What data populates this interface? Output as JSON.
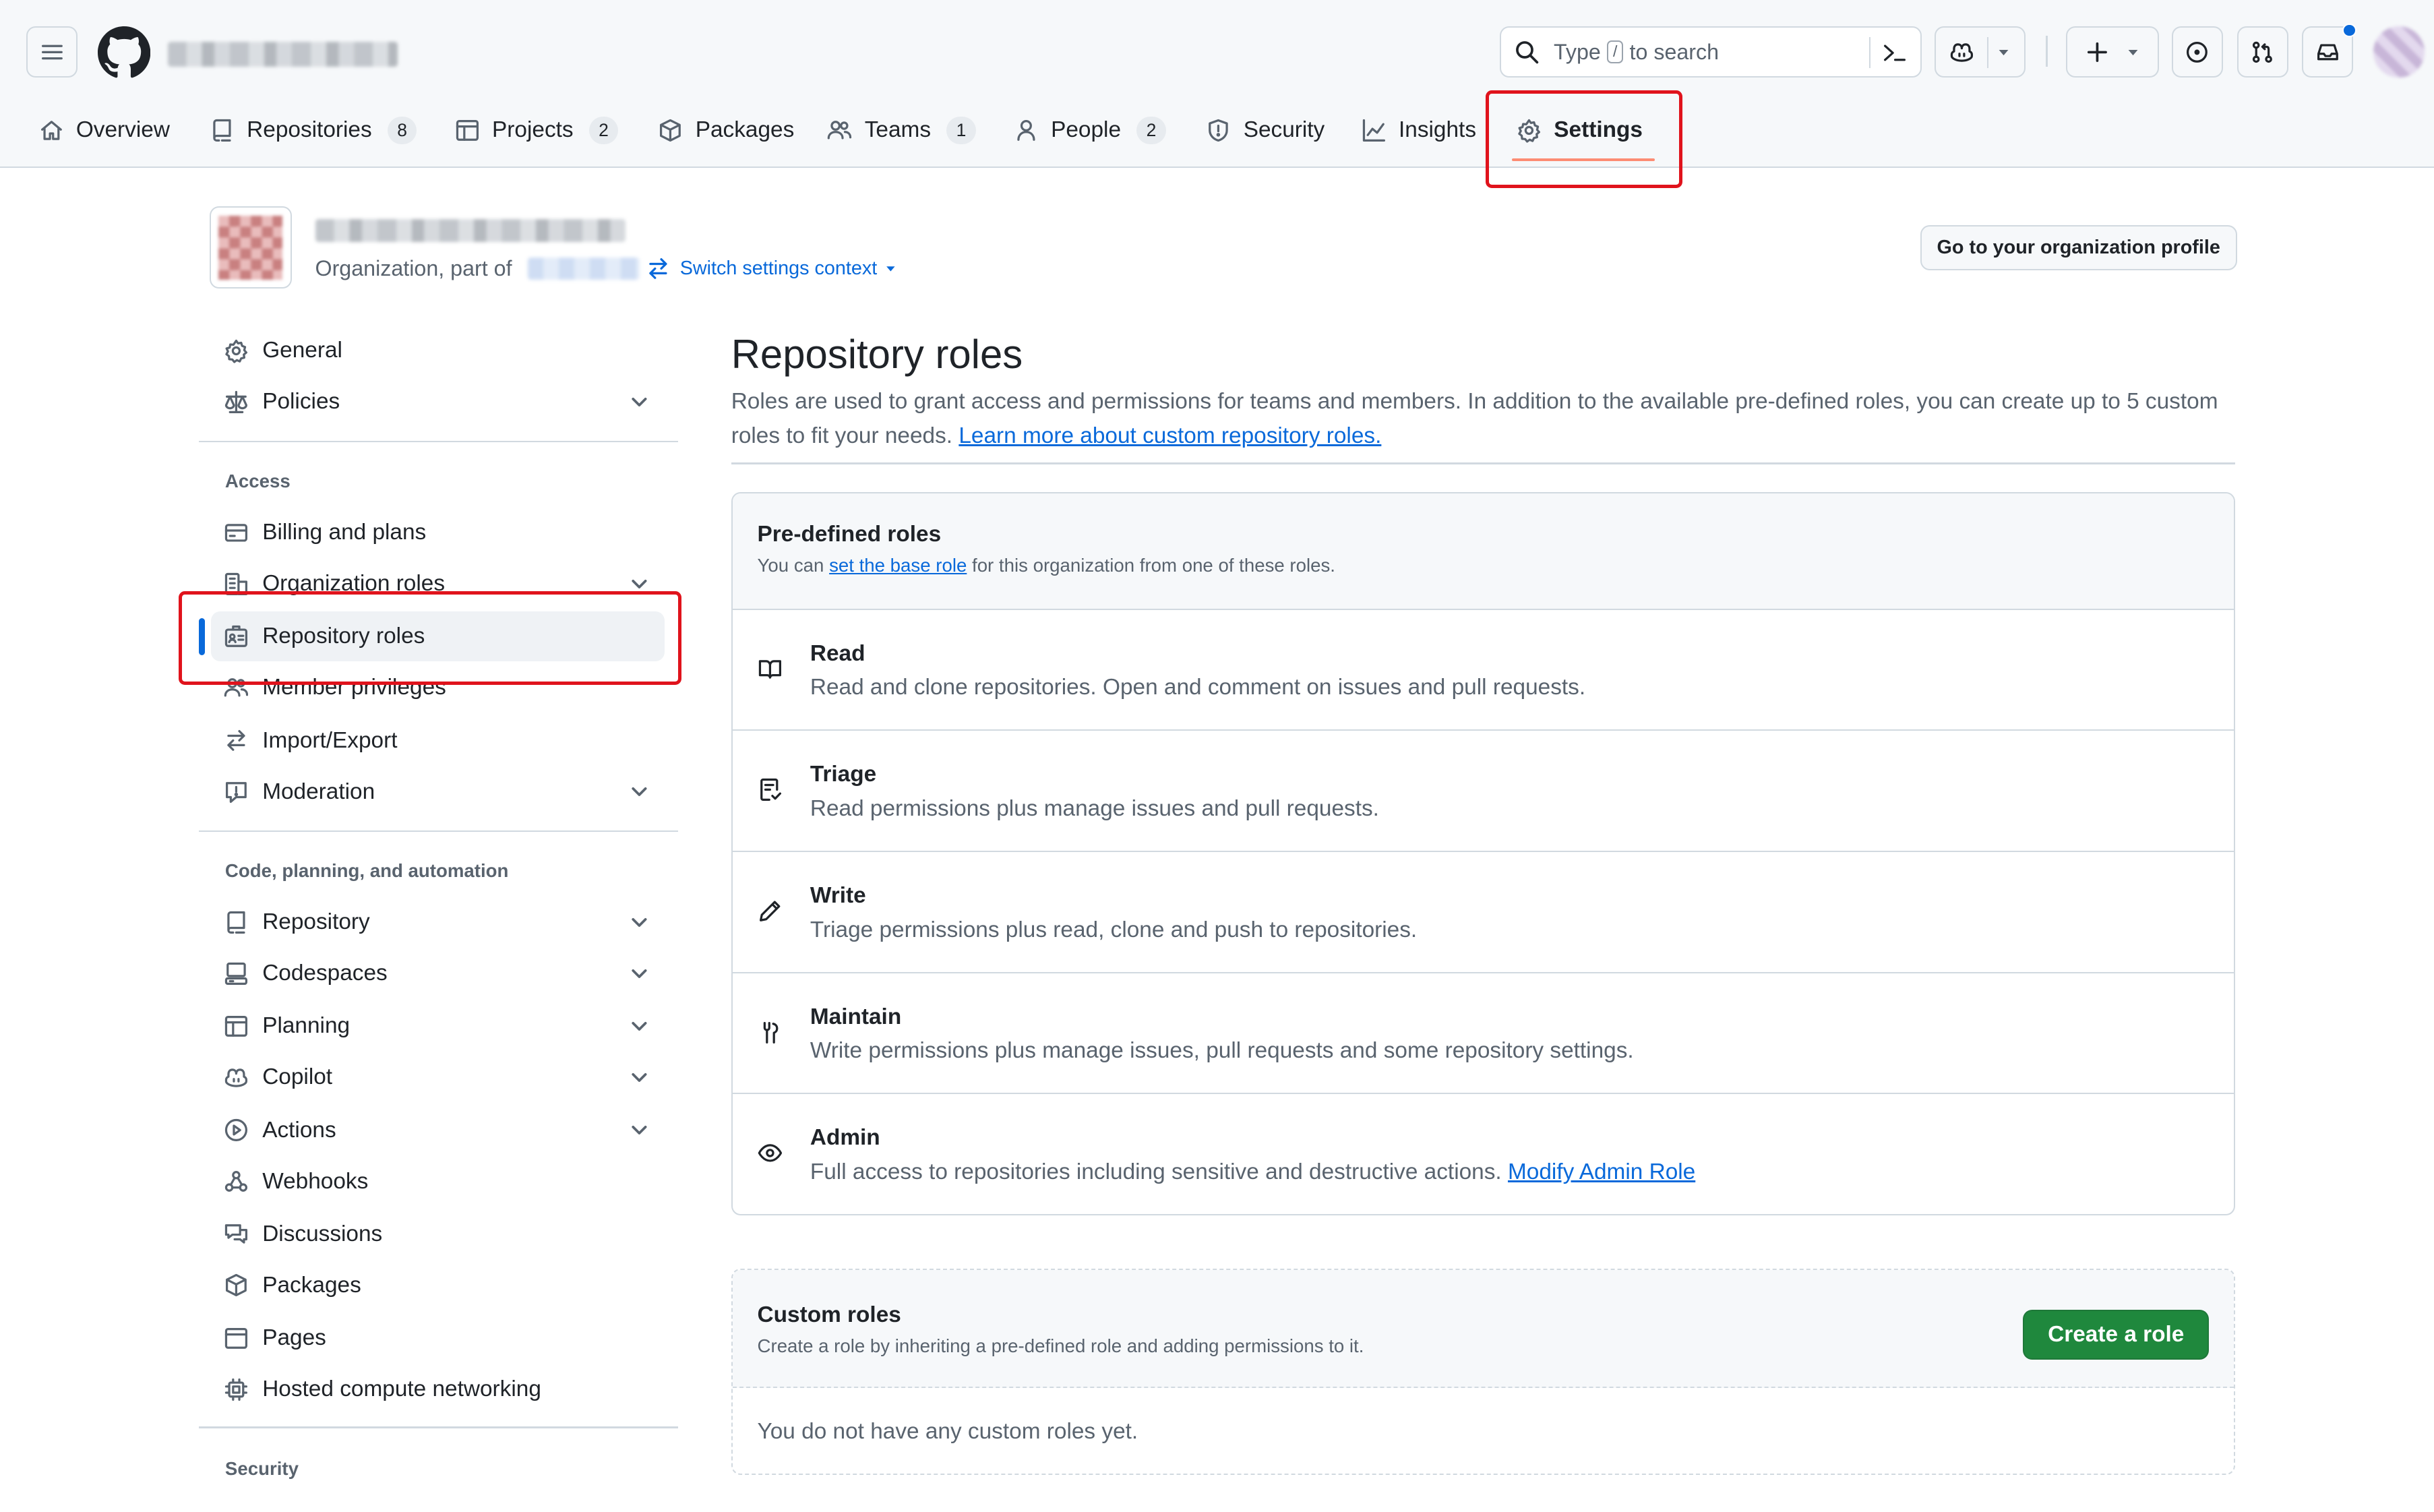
{
  "header": {
    "search_prefix": "Type",
    "search_key": "/",
    "search_suffix": "to search"
  },
  "tabs": [
    {
      "label": "Overview",
      "icon": "home-icon"
    },
    {
      "label": "Repositories",
      "count": "8",
      "icon": "repo-icon"
    },
    {
      "label": "Projects",
      "count": "2",
      "icon": "table-icon"
    },
    {
      "label": "Packages",
      "icon": "package-icon"
    },
    {
      "label": "Teams",
      "count": "1",
      "icon": "people-icon"
    },
    {
      "label": "People",
      "count": "2",
      "icon": "person-icon"
    },
    {
      "label": "Security",
      "icon": "shield-icon"
    },
    {
      "label": "Insights",
      "icon": "graph-icon"
    },
    {
      "label": "Settings",
      "icon": "gear-icon",
      "selected": true
    }
  ],
  "org": {
    "subtitle": "Organization, part of",
    "switch_label": "Switch settings context",
    "profile_button": "Go to your organization profile"
  },
  "sidebar": {
    "top": [
      {
        "label": "General",
        "icon": "gear-icon"
      },
      {
        "label": "Policies",
        "icon": "law-icon",
        "expandable": true
      }
    ],
    "access_heading": "Access",
    "access": [
      {
        "label": "Billing and plans",
        "icon": "credit-card-icon"
      },
      {
        "label": "Organization roles",
        "icon": "organization-icon",
        "expandable": true
      },
      {
        "label": "Repository roles",
        "icon": "id-badge-icon",
        "active": true
      },
      {
        "label": "Member privileges",
        "icon": "people-icon"
      },
      {
        "label": "Import/Export",
        "icon": "arrow-switch-icon"
      },
      {
        "label": "Moderation",
        "icon": "report-icon",
        "expandable": true
      }
    ],
    "code_heading": "Code, planning, and automation",
    "code": [
      {
        "label": "Repository",
        "icon": "repo-icon",
        "expandable": true
      },
      {
        "label": "Codespaces",
        "icon": "codespaces-icon",
        "expandable": true
      },
      {
        "label": "Planning",
        "icon": "table-icon",
        "expandable": true
      },
      {
        "label": "Copilot",
        "icon": "copilot-icon",
        "expandable": true
      },
      {
        "label": "Actions",
        "icon": "play-icon",
        "expandable": true
      },
      {
        "label": "Webhooks",
        "icon": "webhook-icon"
      },
      {
        "label": "Discussions",
        "icon": "comment-discussion-icon"
      },
      {
        "label": "Packages",
        "icon": "package-icon"
      },
      {
        "label": "Pages",
        "icon": "browser-icon"
      },
      {
        "label": "Hosted compute networking",
        "icon": "cpu-icon"
      }
    ],
    "security_heading": "Security"
  },
  "main": {
    "title": "Repository roles",
    "desc": "Roles are used to grant access and permissions for teams and members. In addition to the available pre-defined roles, you can create up to 5 custom roles to fit your needs.",
    "desc_link": "Learn more about custom repository roles.",
    "predefined": {
      "title": "Pre-defined roles",
      "sub_pre": "You can",
      "sub_link": "set the base role",
      "sub_post": "for this organization from one of these roles.",
      "roles": [
        {
          "name": "Read",
          "desc": "Read and clone repositories. Open and comment on issues and pull requests.",
          "icon": "book-icon"
        },
        {
          "name": "Triage",
          "desc": "Read permissions plus manage issues and pull requests.",
          "icon": "checklist-icon"
        },
        {
          "name": "Write",
          "desc": "Triage permissions plus read, clone and push to repositories.",
          "icon": "pencil-icon"
        },
        {
          "name": "Maintain",
          "desc": "Write permissions plus manage issues, pull requests and some repository settings.",
          "icon": "tools-icon"
        },
        {
          "name": "Admin",
          "desc": "Full access to repositories including sensitive and destructive actions.",
          "link": "Modify Admin Role",
          "icon": "eye-icon"
        }
      ]
    },
    "custom": {
      "title": "Custom roles",
      "sub": "Create a role by inheriting a pre-defined role and adding permissions to it.",
      "button": "Create a role",
      "empty": "You do not have any custom roles yet."
    }
  },
  "colors": {
    "accent": "#0969da",
    "highlight": "#e0131c",
    "primary_button": "#1f883d",
    "tab_underline": "#fd8c73"
  }
}
